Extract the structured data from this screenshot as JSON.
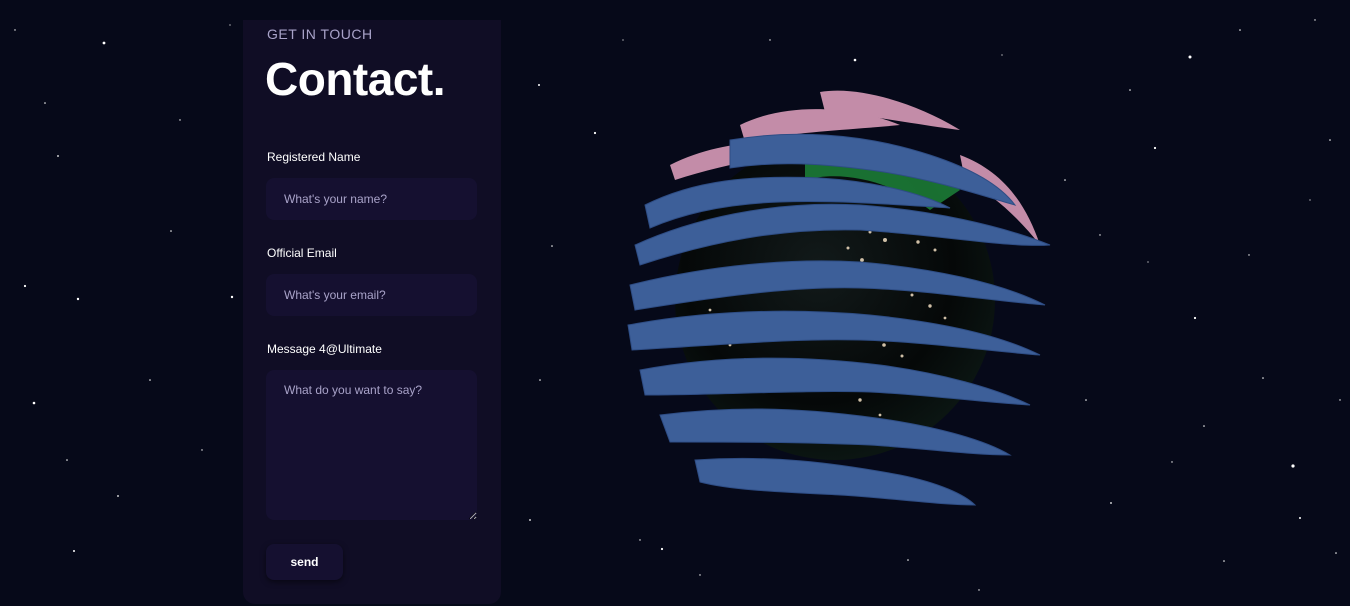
{
  "contact": {
    "eyebrow": "GET IN TOUCH",
    "title": "Contact.",
    "name_label": "Registered Name",
    "name_placeholder": "What's your name?",
    "email_label": "Official Email",
    "email_placeholder": "What's your email?",
    "message_label": "Message 4@Ultimate",
    "message_placeholder": "What do you want to say?",
    "send_label": "send"
  },
  "colors": {
    "background": "#060919",
    "card": "#100d25",
    "field": "#151030",
    "secondary_text": "#a9a3c9"
  },
  "icons": [
    "earth-globe-3d"
  ]
}
